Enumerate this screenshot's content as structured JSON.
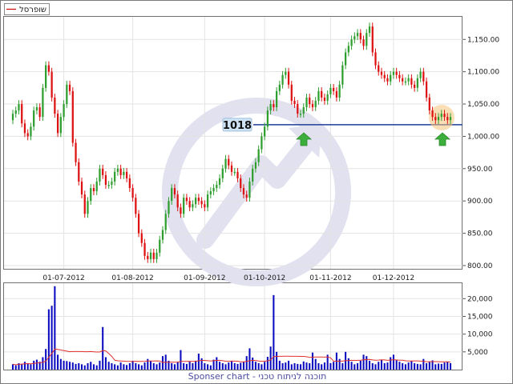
{
  "legend": {
    "label": "שופרסל",
    "line_color": "#cc0000"
  },
  "support_level": {
    "label": "1018",
    "value": 1018,
    "color": "#1f3d99",
    "box_color": "#cfe3f5"
  },
  "footer": {
    "text": "Sponser chart - תוכנה לניתוח טכני",
    "color": "#4a4aa0"
  },
  "colors": {
    "up": "#2e9e2e",
    "down": "#dd1111",
    "volume": "#0b0bc0",
    "volume_ma": "#e03030",
    "watermark": "#d9d9ea",
    "arrow": "#3cae3c",
    "highlight": "#f5c27a"
  },
  "chart_data": {
    "type": "candlestick",
    "price_axis": {
      "min": 800,
      "max": 1150,
      "ticks": [
        "800.00",
        "850.00",
        "900.00",
        "950.00",
        "1,000.00",
        "1,050.00",
        "1,100.00",
        "1,150.00"
      ],
      "tick_values": [
        800,
        850,
        900,
        950,
        1000,
        1050,
        1100,
        1150
      ]
    },
    "volume_axis": {
      "ticks": [
        "5,000",
        "10,000",
        "15,000",
        "20,000"
      ],
      "tick_values": [
        5000,
        10000,
        15000,
        20000
      ],
      "max": 23000
    },
    "x_labels": [
      "01-07-2012",
      "01-08-2012",
      "01-09-2012",
      "01-10-2012",
      "01-11-2012",
      "01-12-2012"
    ],
    "x_label_index": [
      17,
      40,
      64,
      84,
      106,
      127
    ],
    "close": [
      1035,
      1040,
      1050,
      1020,
      1005,
      1000,
      1015,
      1040,
      1045,
      1030,
      1075,
      1110,
      1100,
      1060,
      1035,
      1005,
      1030,
      1050,
      1080,
      1070,
      990,
      960,
      930,
      910,
      880,
      900,
      920,
      915,
      930,
      950,
      940,
      925,
      925,
      930,
      945,
      950,
      940,
      945,
      935,
      920,
      905,
      880,
      850,
      835,
      815,
      810,
      820,
      810,
      820,
      840,
      855,
      880,
      900,
      920,
      910,
      890,
      880,
      905,
      900,
      890,
      895,
      905,
      900,
      895,
      890,
      910,
      915,
      920,
      925,
      935,
      950,
      965,
      955,
      945,
      945,
      935,
      920,
      910,
      905,
      930,
      950,
      960,
      980,
      1000,
      1015,
      1040,
      1050,
      1045,
      1070,
      1080,
      1095,
      1100,
      1080,
      1055,
      1050,
      1035,
      1035,
      1045,
      1060,
      1050,
      1045,
      1055,
      1070,
      1060,
      1055,
      1065,
      1075,
      1070,
      1060,
      1080,
      1110,
      1130,
      1140,
      1150,
      1155,
      1160,
      1150,
      1140,
      1160,
      1170,
      1130,
      1110,
      1100,
      1095,
      1090,
      1085,
      1095,
      1100,
      1095,
      1090,
      1085,
      1085,
      1090,
      1080,
      1075,
      1090,
      1100,
      1085,
      1060,
      1040,
      1030,
      1025,
      1030,
      1035,
      1030,
      1025,
      1030
    ],
    "volume": [
      1500,
      1200,
      1800,
      1600,
      2200,
      1800,
      1500,
      2500,
      2800,
      2200,
      3500,
      5800,
      17000,
      18000,
      23500,
      4200,
      3000,
      2500,
      2400,
      2200,
      2000,
      1600,
      1800,
      1500,
      1200,
      1800,
      2200,
      1500,
      1200,
      2500,
      12000,
      3500,
      2200,
      1800,
      1500,
      1200,
      2000,
      1500,
      1300,
      1800,
      2500,
      1800,
      1500,
      1200,
      2000,
      3000,
      2500,
      1800,
      1500,
      2000,
      3800,
      4200,
      2500,
      1800,
      1500,
      2200,
      5500,
      1800,
      1600,
      2200,
      1800,
      2500,
      4500,
      3200,
      1800,
      1500,
      1200,
      2800,
      3500,
      2200,
      1800,
      1500,
      2000,
      2500,
      1800,
      1600,
      1900,
      2200,
      3800,
      6000,
      3400,
      2200,
      1800,
      1500,
      2200,
      3600,
      6500,
      21000,
      5000,
      2500,
      1800,
      2000,
      2500,
      1500,
      1800,
      1600,
      1500,
      2300,
      2000,
      1800,
      4800,
      3000,
      1800,
      1500,
      2000,
      4200,
      1800,
      2200,
      4800,
      3000,
      1800,
      5000,
      3200,
      2200,
      1500,
      1800,
      2500,
      4200,
      3800,
      2500,
      1800,
      1500,
      2200,
      2800,
      1800,
      2000,
      3500,
      4200,
      2800,
      2200,
      1800,
      1500,
      2000,
      2500,
      1800,
      1600,
      1500,
      3000,
      1800,
      2200,
      2600,
      1500,
      1700,
      1600,
      2000,
      2200,
      1800
    ]
  }
}
